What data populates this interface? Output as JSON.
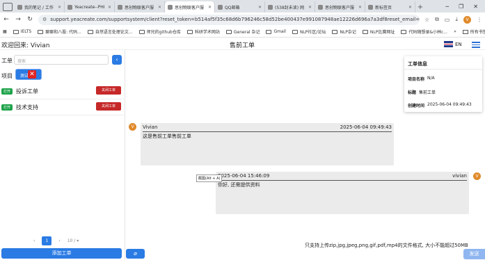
{
  "browser": {
    "tabs": [
      {
        "label": "我的笔记 / 工作"
      },
      {
        "label": "Yeacreate--PHI"
      },
      {
        "label": "思创物联客户服"
      },
      {
        "label": "思创物联客户服"
      },
      {
        "label": "QQ邮箱"
      },
      {
        "label": "(538封未读) 网"
      },
      {
        "label": "思创物联客户服"
      },
      {
        "label": "新标签页"
      }
    ],
    "url": "support.yeacreate.com/supportsystem/client?reset_token=b514af5f35c68d6b796246c58d52be400437e991087948ae12226d696a7a3df8reset_email=528290596@qq.com...",
    "bookmarks": [
      "IELTS",
      "聊聊和八股: 代码...",
      "自然语言处理论文...",
      "师兄的github仓库",
      "科研学术网站",
      "General 杂记",
      "Gmail",
      "NLP社区/论坛",
      "NLP杂记",
      "NLP比赛网址",
      "代码随想录&小林c..."
    ],
    "all_bookmarks": "所有书签"
  },
  "header": {
    "welcome": "欢迎回来: Vivian",
    "title": "售前工单",
    "lang": "EN"
  },
  "sidebar": {
    "ticket_label": "工单",
    "search_placeholder": "搜索",
    "collapse_icon": "‹",
    "project_label": "项目",
    "project_btn": "测试",
    "project_remove": "✕",
    "tickets": [
      {
        "status": "打开",
        "name": "投诉工单",
        "close": "关闭工单"
      },
      {
        "status": "打开",
        "name": "技术支持",
        "close": "关闭工单"
      }
    ],
    "pager": {
      "prev": "‹",
      "page": "1",
      "next": "›",
      "size": "10 / ▾"
    },
    "add_button": "添加工单"
  },
  "info": {
    "heading": "工单信息",
    "rows": [
      {
        "k": "项目名称",
        "v": "N/A"
      },
      {
        "k": "标题",
        "v": "售前工单"
      },
      {
        "k": "创建时间",
        "v": "2025-06-04 09:49:43"
      }
    ]
  },
  "messages": [
    {
      "avatar": "V",
      "from": "Vivian",
      "time": "2025-06-04 09:49:43",
      "text": "这是售前工单售前工单"
    },
    {
      "avatar": "V",
      "from": "vivian",
      "time": "2025-06-04 15:46:09",
      "text": "你好, 还需提供资料"
    }
  ],
  "screenshot_tooltip": "截图(Alt + A)",
  "footer": {
    "attach_icon": "⌀",
    "hint": "只支持上传zip,jpg,jpeg,png,gif,pdf,mp4的文件格式, 大小不能超过50MB",
    "send": "发送"
  },
  "colors": {
    "primary": "#2a7be4",
    "danger": "#c62828",
    "success": "#1ea34a",
    "avatar": "#e08a2c"
  }
}
